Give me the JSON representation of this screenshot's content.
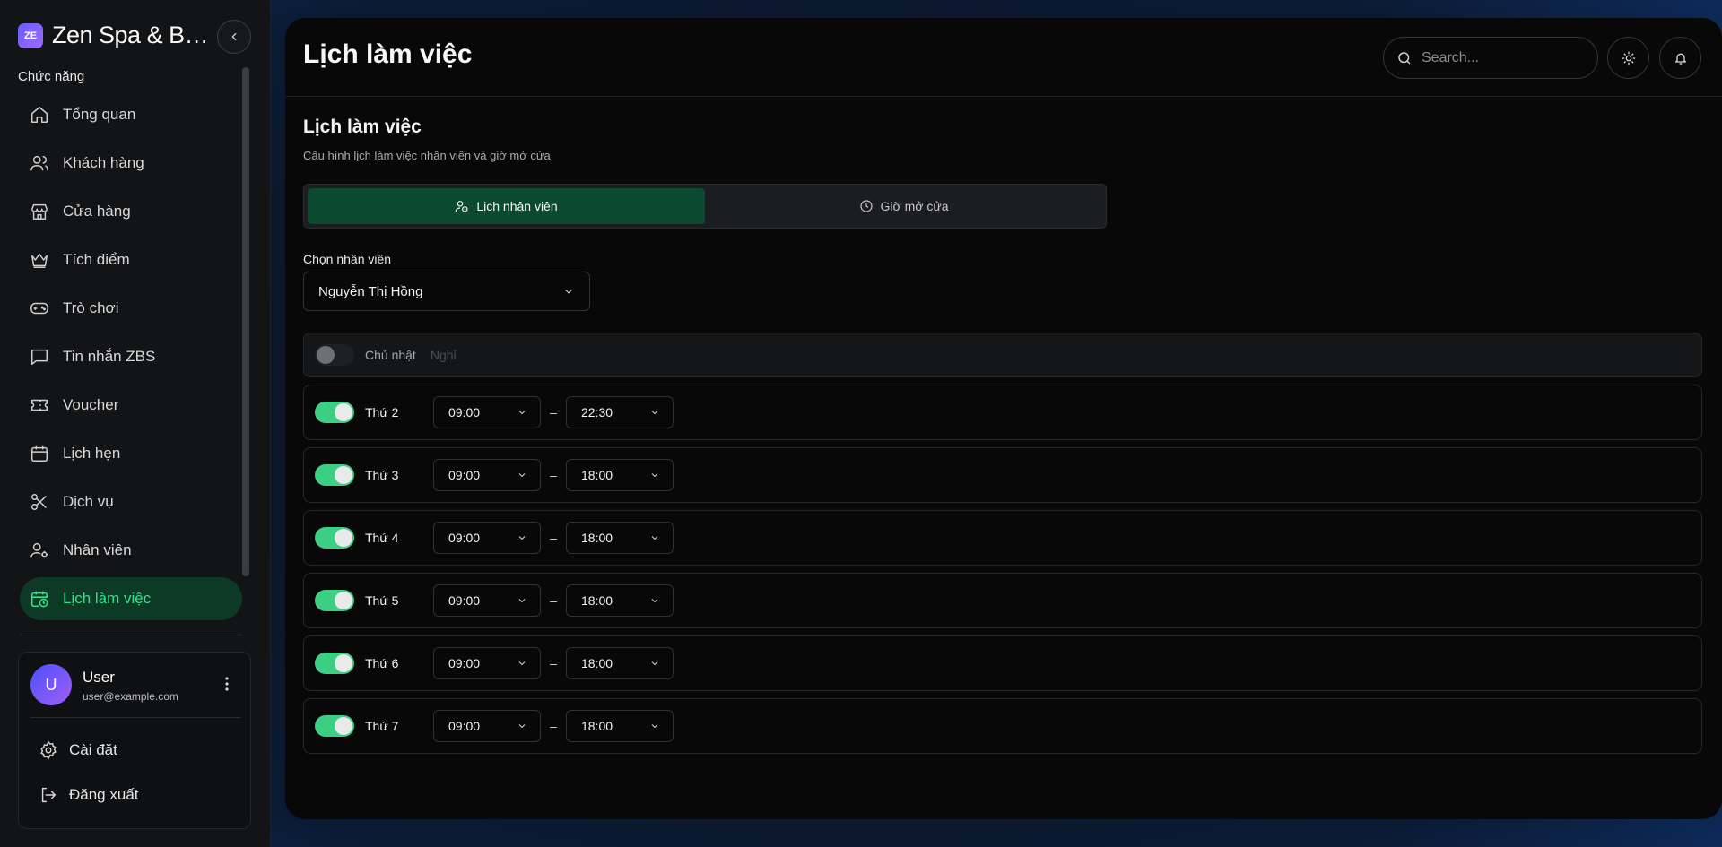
{
  "app": {
    "logo_text": "ZE",
    "name": "Zen Spa & Beauty",
    "name_display": "Zen Spa & Bea..."
  },
  "sidebar": {
    "section_label": "Chức năng",
    "items": [
      {
        "label": "Tổng quan",
        "icon": "home-icon"
      },
      {
        "label": "Khách hàng",
        "icon": "users-icon"
      },
      {
        "label": "Cửa hàng",
        "icon": "store-icon"
      },
      {
        "label": "Tích điểm",
        "icon": "crown-icon"
      },
      {
        "label": "Trò chơi",
        "icon": "gamepad-icon"
      },
      {
        "label": "Tin nhắn ZBS",
        "icon": "message-icon"
      },
      {
        "label": "Voucher",
        "icon": "ticket-icon"
      },
      {
        "label": "Lịch hẹn",
        "icon": "calendar-icon"
      },
      {
        "label": "Dịch vụ",
        "icon": "scissors-icon"
      },
      {
        "label": "Nhân viên",
        "icon": "user-cog-icon"
      },
      {
        "label": "Lịch làm việc",
        "icon": "calendar-clock-icon",
        "active": true
      }
    ]
  },
  "user": {
    "initial": "U",
    "name": "User",
    "email": "user@example.com",
    "settings_label": "Cài đặt",
    "logout_label": "Đăng xuất"
  },
  "header": {
    "title": "Lịch làm việc",
    "search_placeholder": "Search..."
  },
  "content": {
    "title": "Lịch làm việc",
    "subtitle": "Cấu hình lịch làm việc nhân viên và giờ mở cửa",
    "tabs": [
      {
        "label": "Lịch nhân viên",
        "active": true
      },
      {
        "label": "Giờ mở cửa",
        "active": false
      }
    ],
    "employee_label": "Chọn nhân viên",
    "employee_value": "Nguyễn Thị Hồng"
  },
  "schedule": {
    "off_day": {
      "name": "Chủ nhật",
      "status": "Nghỉ",
      "enabled": false
    },
    "separator": "–",
    "days": [
      {
        "name": "Thứ 2",
        "start": "09:00",
        "end": "22:30",
        "enabled": true
      },
      {
        "name": "Thứ 3",
        "start": "09:00",
        "end": "18:00",
        "enabled": true
      },
      {
        "name": "Thứ 4",
        "start": "09:00",
        "end": "18:00",
        "enabled": true
      },
      {
        "name": "Thứ 5",
        "start": "09:00",
        "end": "18:00",
        "enabled": true
      },
      {
        "name": "Thứ 6",
        "start": "09:00",
        "end": "18:00",
        "enabled": true
      },
      {
        "name": "Thứ 7",
        "start": "09:00",
        "end": "18:00",
        "enabled": true
      }
    ]
  },
  "colors": {
    "accent": "#3ccf84",
    "active_nav_bg": "#0d3a26",
    "active_tab_bg": "#0b4a2e",
    "logo_gradient": "#6d5bff"
  }
}
